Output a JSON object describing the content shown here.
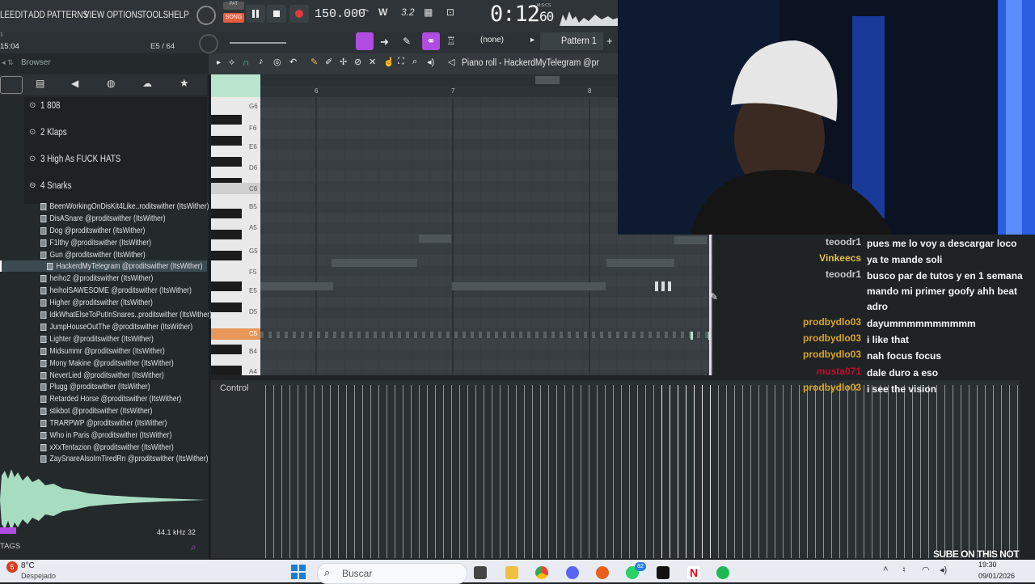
{
  "menu": [
    "LE",
    "EDIT",
    "ADD",
    "PATTERNS",
    "VIEW",
    "OPTIONS",
    "TOOLS",
    "HELP"
  ],
  "transport": {
    "song_label": "SONG",
    "tempo": "150.000",
    "time_main": "0:12",
    "time_sub": "60",
    "time_unit": "M:S:CS"
  },
  "info": {
    "left_time": "15:04",
    "counter": "E5 / 64"
  },
  "pattern": {
    "label": "Pattern 1",
    "none_label": "(none)",
    "add": "+"
  },
  "browser": {
    "title": "Browser",
    "folders": [
      "1 808",
      "2 Klaps",
      "3 High As FUCK HATS",
      "4 Snarks"
    ],
    "files": [
      "BeenWorkingOnDisKit4Like..roditswither (ItsWither)",
      "DisASnare @proditswither (ItsWither)",
      "Dog @proditswither (ItsWither)",
      "F1lthy @proditswither (ItsWither)",
      "Gun @proditswither (ItsWither)",
      "HackerdMyTelegram @proditswither (ItsWither)",
      "heiho2 @proditswither (ItsWither)",
      "heiholSAWESOME @proditswither (ItsWither)",
      "Higher @proditswither (ItsWither)",
      "IdkWhatElseToPutInSnares..proditswither (ItsWither)",
      "JumpHouseOutThe @proditswither (ItsWither)",
      "Lighter @proditswither (ItsWither)",
      "Midsummr @proditswither (ItsWither)",
      "Mony Makine @proditswither (ItsWither)",
      "NeverLied @proditswither (ItsWither)",
      "Plugg @proditswither (ItsWither)",
      "Retarded Horse @proditswither (ItsWither)",
      "stikbot @proditswither (ItsWither)",
      "TRARPWP @proditswither (ItsWither)",
      "Who in Paris @proditswither (ItsWither)",
      "xXxTentazion @proditswither (ItsWither)",
      "ZaySnareAlsoImTiredRn @proditswither (ItsWither)"
    ],
    "sample_rate": "44.1 kHz 32",
    "tags_label": "TAGS"
  },
  "piano_roll": {
    "title": "Piano roll - HackerdMyTelegram @pr",
    "bar_numbers": [
      "6",
      "7",
      "8"
    ],
    "key_labels": [
      "G6",
      "F6",
      "E6",
      "D6",
      "C6",
      "B5",
      "A5",
      "G5",
      "F5",
      "E5",
      "D5",
      "C5",
      "B4",
      "A4"
    ],
    "control_label": "Control"
  },
  "chat": [
    {
      "user": "teoodr1",
      "color": "#c8c8c8",
      "msg": "pues me lo voy a descargar loco"
    },
    {
      "user": "Vinkeecs",
      "color": "#e6c13c",
      "msg": "ya te mande soli"
    },
    {
      "user": "teoodr1",
      "color": "#c8c8c8",
      "msg": "busco par de tutos y en 1 semana mando mi primer goofy ahh beat adro"
    },
    {
      "user": "prodbydlo03",
      "color": "#d9a52b",
      "msg": "dayummmmmmmmmm"
    },
    {
      "user": "prodbydlo03",
      "color": "#d9a52b",
      "msg": "i like that"
    },
    {
      "user": "prodbydlo03",
      "color": "#d9a52b",
      "msg": "nah focus focus"
    },
    {
      "user": "musta071",
      "color": "#c0102a",
      "msg": "dale duro a eso"
    },
    {
      "user": "prodbydlo03",
      "color": "#d9a52b",
      "msg": "i see the vision"
    }
  ],
  "taskbar": {
    "weather_temp": "8°C",
    "weather_desc": "Despejado",
    "weather_badge": "5",
    "search_placeholder": "Buscar",
    "whatsapp_badge": "82",
    "time": "19:30",
    "date": "09/01/2026"
  },
  "overlay": {
    "watermark": "SUBE ON THIS NOT"
  }
}
